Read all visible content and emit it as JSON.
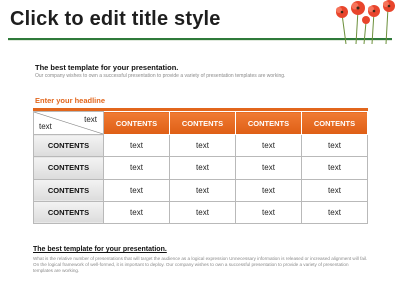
{
  "slide": {
    "title": "Click to edit title style",
    "flower_icon": "red-poppy-flowers-icon",
    "accent_color": "#e2661c",
    "rule_color": "#2f7a3a"
  },
  "intro": {
    "heading": "The best template for your presentation.",
    "text": "Our company wishes to own a successful presentation to provide a variety of presentation templates are working."
  },
  "headline": "Enter your headline",
  "table": {
    "corner_top_right": "text",
    "corner_bottom_left": "text",
    "column_headers": [
      "CONTENTS",
      "CONTENTS",
      "CONTENTS",
      "CONTENTS"
    ],
    "rows": [
      {
        "header": "CONTENTS",
        "cells": [
          "text",
          "text",
          "text",
          "text"
        ]
      },
      {
        "header": "CONTENTS",
        "cells": [
          "text",
          "text",
          "text",
          "text"
        ]
      },
      {
        "header": "CONTENTS",
        "cells": [
          "text",
          "text",
          "text",
          "text"
        ]
      },
      {
        "header": "CONTENTS",
        "cells": [
          "text",
          "text",
          "text",
          "text"
        ]
      }
    ]
  },
  "footer": {
    "heading": "The best template for your presentation.",
    "text": "What is the relative number of presentations that will target the audience as a logical expression Unnecessary information is released or increased alignment will fail. On the logical framework of well-formed, it is important to deploy. Our company wishes to own a successful presentation to provide a variety of presentation templates are working."
  }
}
